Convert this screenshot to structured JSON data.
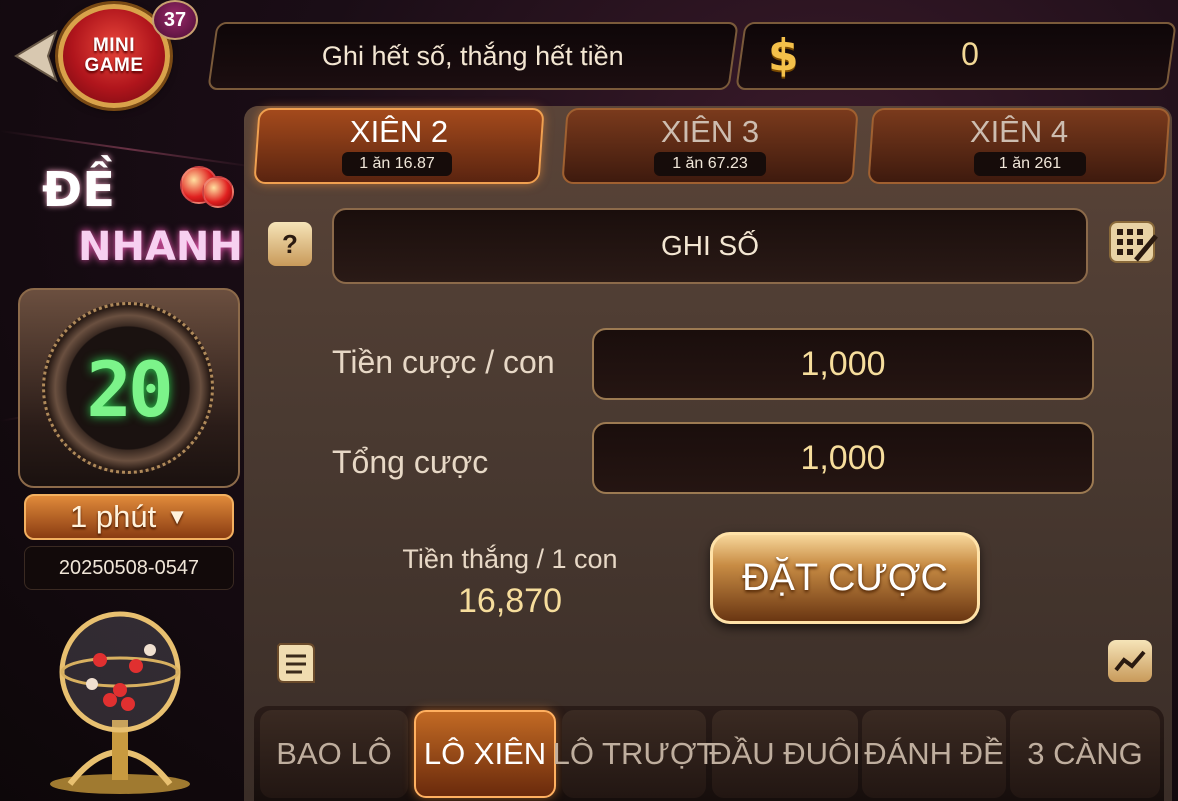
{
  "header": {
    "mini_game": [
      "MINI",
      "GAME"
    ],
    "badge_count": "37",
    "slogan": "Ghi hết số, thắng hết tiền",
    "coin_symbol": "$",
    "balance": "0"
  },
  "logo": {
    "line1": "ĐỀ",
    "line2": "NHANH"
  },
  "timer": {
    "countdown": "20",
    "interval": "1 phút",
    "session_id": "20250508-0547"
  },
  "tabs": [
    {
      "label": "XIÊN 2",
      "odds": "1 ăn 16.87",
      "active": true
    },
    {
      "label": "XIÊN 3",
      "odds": "1 ăn 67.23",
      "active": false
    },
    {
      "label": "XIÊN 4",
      "odds": "1 ăn 261",
      "active": false
    }
  ],
  "form": {
    "number_field": "GHI SỐ",
    "stake_label": "Tiền cược / con",
    "stake_value": "1,000",
    "total_label": "Tổng cược",
    "total_value": "1,000",
    "win_label": "Tiền thắng / 1 con",
    "win_value": "16,870",
    "bet_button": "ĐẶT CƯỢC"
  },
  "bottom_tabs": [
    {
      "label": "BAO LÔ",
      "active": false
    },
    {
      "label": "LÔ XIÊN",
      "active": true
    },
    {
      "label": "LÔ TRƯỢT",
      "active": false
    },
    {
      "label": "ĐẦU ĐUÔI",
      "active": false
    },
    {
      "label": "ĐÁNH ĐỀ",
      "active": false
    },
    {
      "label": "3 CÀNG",
      "active": false
    }
  ],
  "colors": {
    "accent": "#f0a050",
    "timer_digits": "#7cf48a",
    "value_gold": "#f6dd9c"
  }
}
